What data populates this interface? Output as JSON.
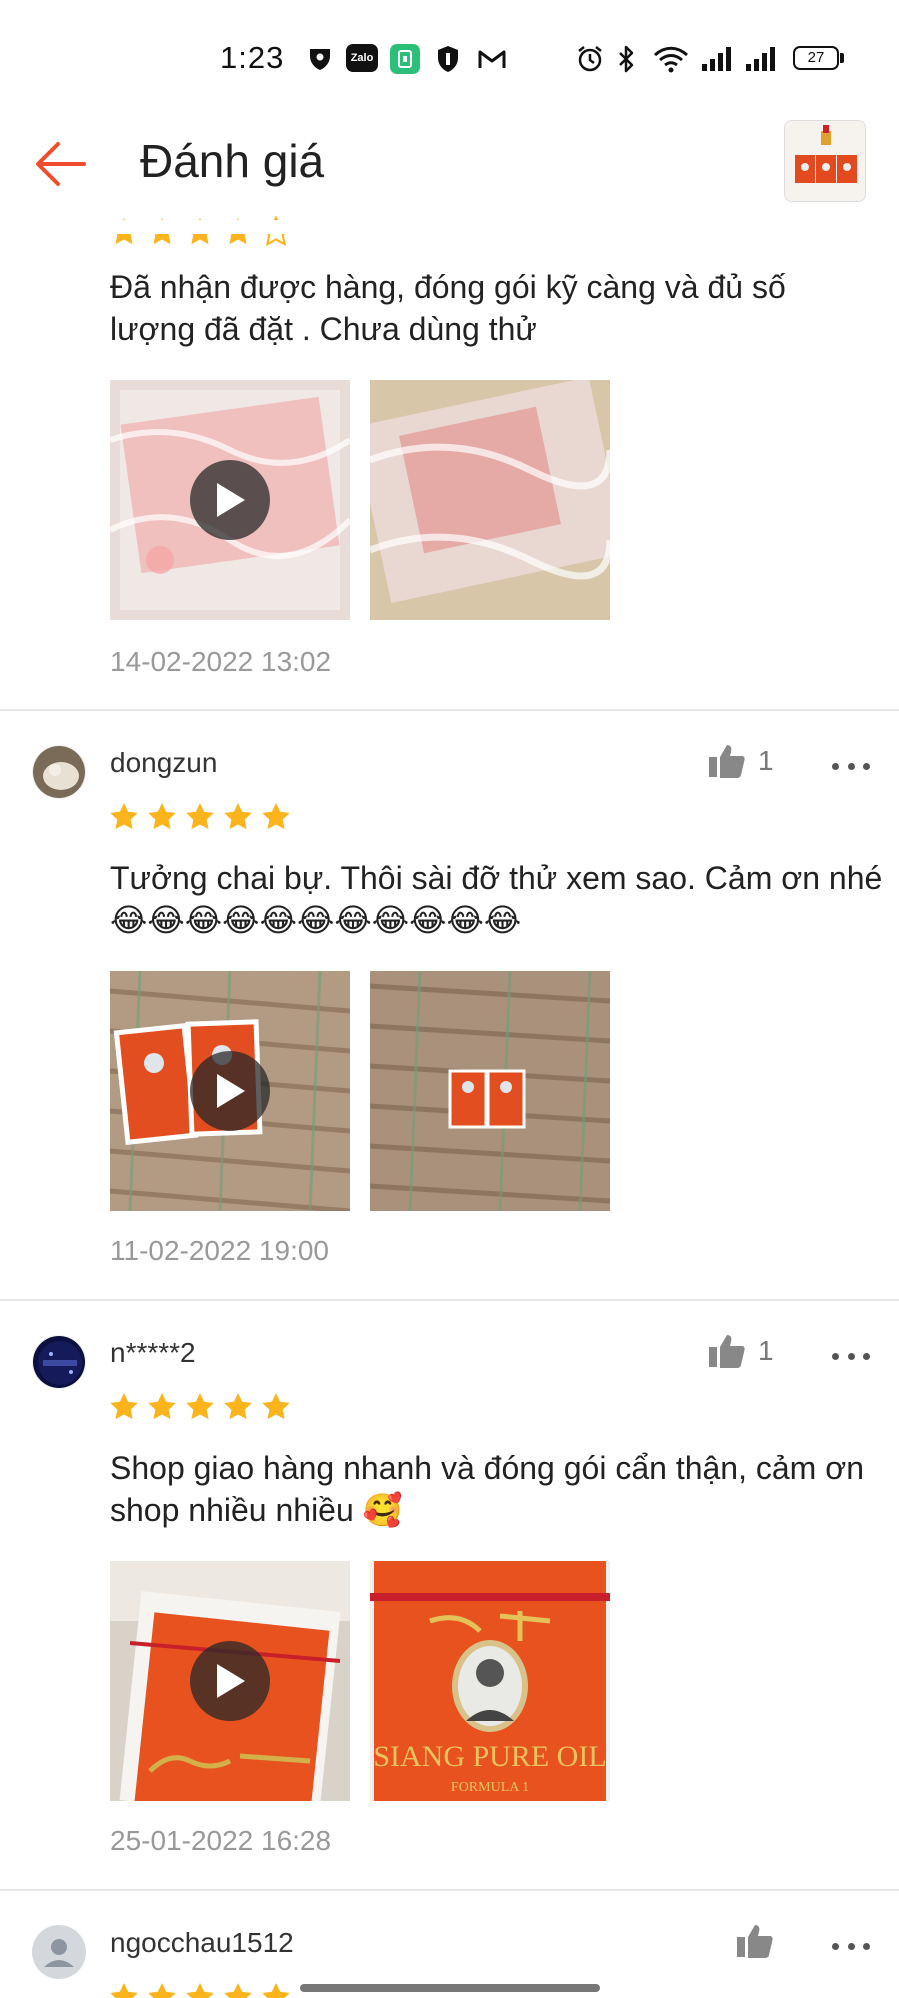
{
  "status_bar": {
    "time": "1:23",
    "zalo_label": "Zalo",
    "battery": "27",
    "icons": [
      "shield-vpn-icon",
      "zalo-icon",
      "green-app-icon",
      "security-icon",
      "gmail-icon",
      "alarm-icon",
      "bluetooth-icon",
      "wifi-icon",
      "signal-icon",
      "signal-icon",
      "battery-icon"
    ]
  },
  "header": {
    "title": "Đánh giá",
    "back_icon": "arrow-left-icon",
    "accent_color": "#ee4d2d"
  },
  "colors": {
    "star": "#fbb41c",
    "date": "#999999"
  },
  "reviews": [
    {
      "username": "",
      "rating": 4,
      "text": "Đã nhận được hàng, đóng gói kỹ càng và đủ số lượng đã đặt . Chưa dùng thử",
      "media": [
        {
          "type": "video",
          "description": "packaging-video"
        },
        {
          "type": "image",
          "description": "packaging-photo"
        }
      ],
      "date": "14-02-2022 13:02"
    },
    {
      "username": "dongzun",
      "likes": "1",
      "rating": 5,
      "text": "Tưởng chai bự. Thôi sài đỡ thử xem sao. Cảm ơn nhé 😂😂😂😂😂😂😂😂😂😂😂",
      "media": [
        {
          "type": "video",
          "description": "product-boxes-video"
        },
        {
          "type": "image",
          "description": "product-boxes-photo"
        }
      ],
      "date": "11-02-2022 19:00"
    },
    {
      "username": "n*****2",
      "likes": "1",
      "rating": 5,
      "text": "Shop giao hàng nhanh và đóng gói cẩn thận, cảm ơn shop nhiều nhiều 🥰",
      "media": [
        {
          "type": "video",
          "description": "product-box-video"
        },
        {
          "type": "image",
          "description": "product-box-photo",
          "caption": "SIANG PURE OIL",
          "subcaption": "FORMULA 1"
        }
      ],
      "date": "25-01-2022 16:28"
    },
    {
      "username": "ngocchau1512",
      "likes": "",
      "rating": 5
    }
  ]
}
